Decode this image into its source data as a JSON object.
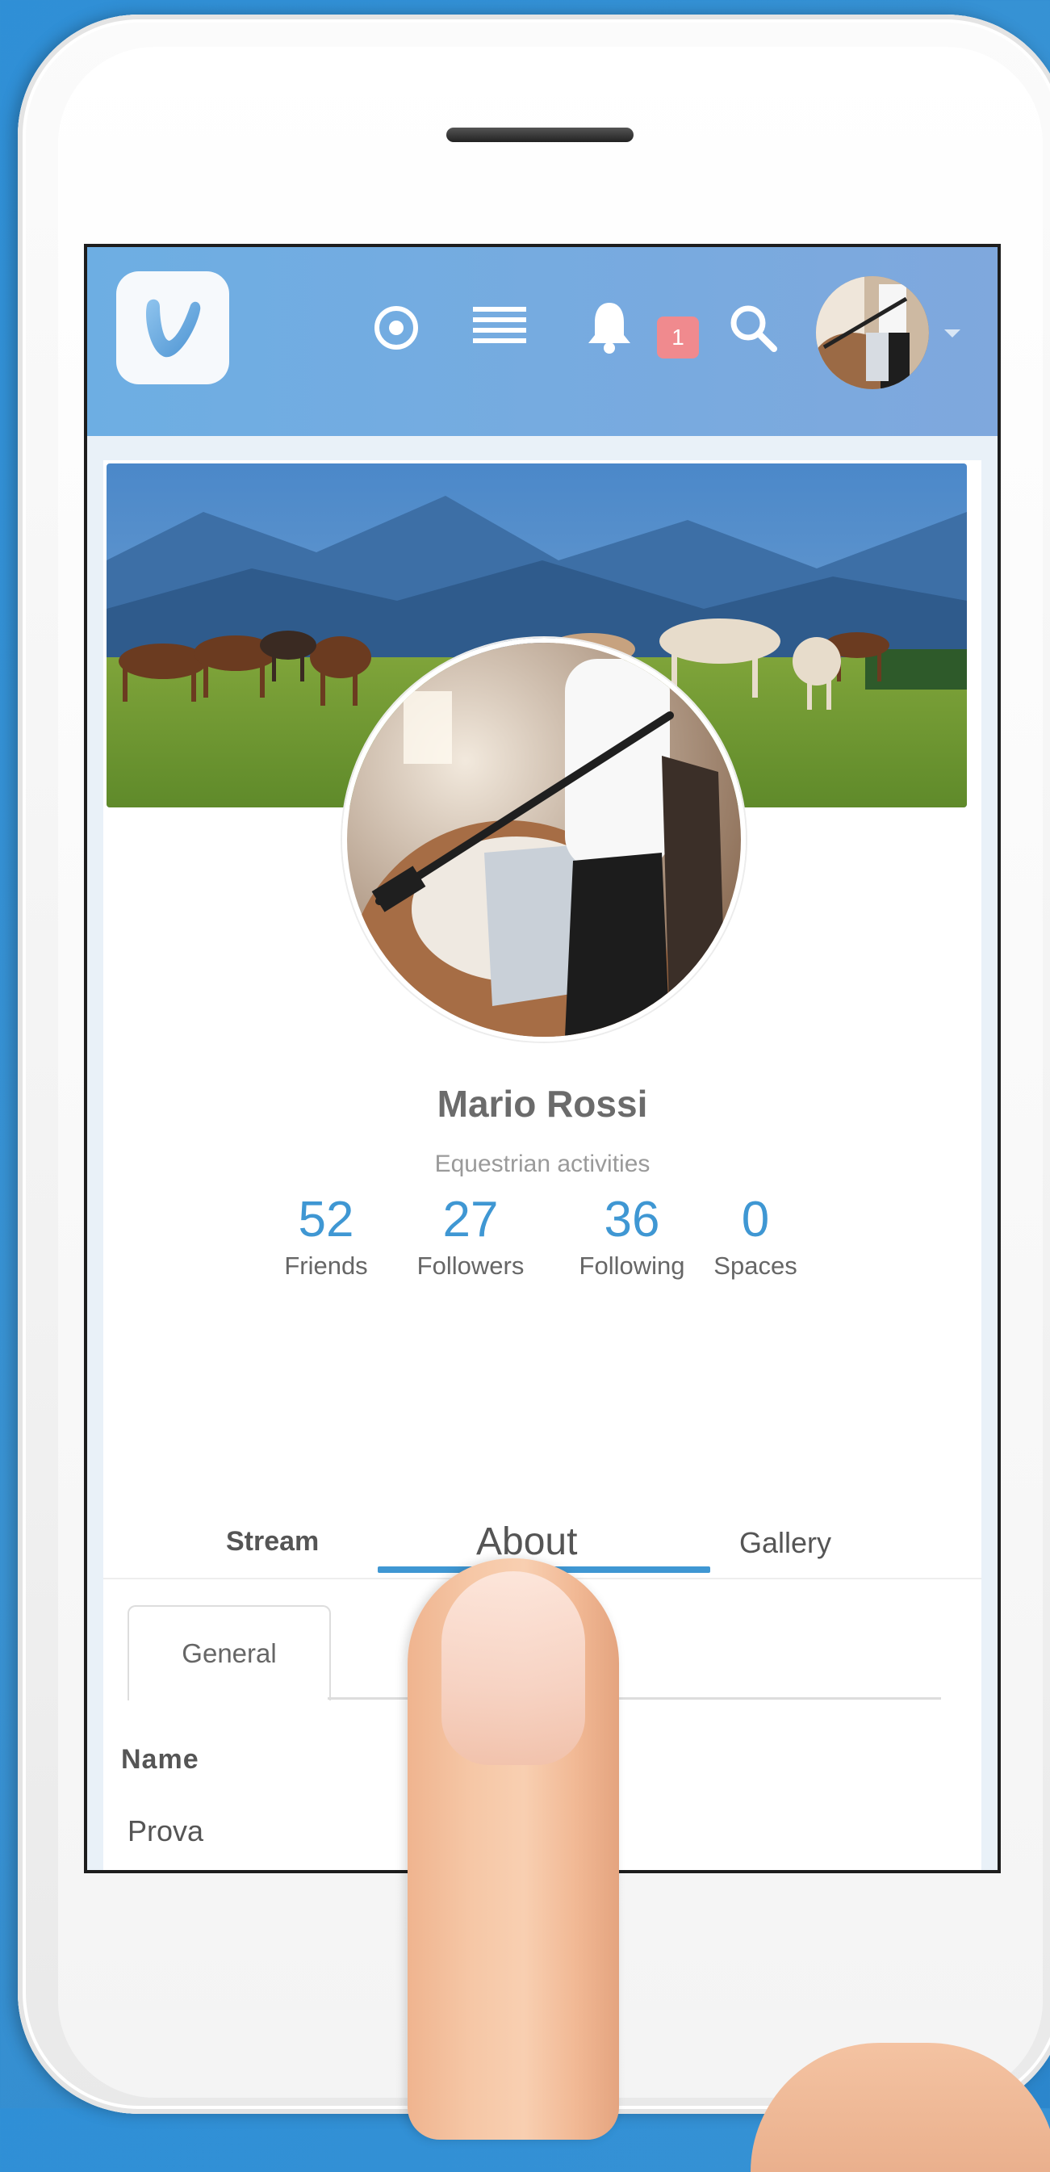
{
  "header": {
    "notification_count": "1",
    "icons": [
      "app-logo",
      "target-icon",
      "list-icon",
      "bell-icon",
      "search-icon",
      "user-avatar",
      "caret-down-icon"
    ]
  },
  "profile": {
    "name": "Mario Rossi",
    "subtitle": "Equestrian activities"
  },
  "stats": [
    {
      "value": "52",
      "label": "Friends"
    },
    {
      "value": "27",
      "label": "Followers"
    },
    {
      "value": "36",
      "label": "Following"
    },
    {
      "value": "0",
      "label": "Spaces"
    }
  ],
  "tabs": {
    "stream": "Stream",
    "about": "About",
    "gallery": "Gallery",
    "active": "About"
  },
  "subtabs": {
    "general": "General"
  },
  "fields": {
    "name_label": "Name",
    "name_value": "Prova"
  },
  "colors": {
    "header_start": "#6daee3",
    "header_end": "#7fa8dd",
    "accent": "#3f97d3",
    "badge": "#f08a8e",
    "background": "#2f8fd6"
  }
}
